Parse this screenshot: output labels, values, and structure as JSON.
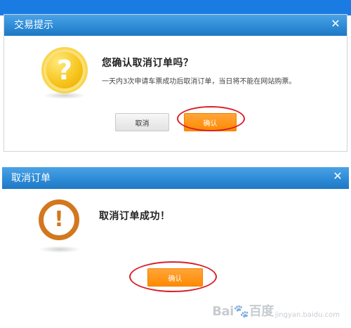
{
  "colors": {
    "top_strip": "#1a7be3",
    "titlebar": "#2e8bd6",
    "confirm_button": "#ff8a00",
    "alert_ring": "#d2781e",
    "question_icon": "#f6c31a",
    "highlight_ellipse": "#d8202a"
  },
  "dialog_trade": {
    "title": "交易提示",
    "close_glyph": "✕",
    "icon": "question-icon",
    "icon_glyph": "?",
    "heading": "您确认取消订单吗？",
    "message": "一天内3次申请车票成功后取消订单，当日将不能在网站购票。",
    "cancel_label": "取消",
    "confirm_label": "确认"
  },
  "dialog_cancel": {
    "title": "取消订单",
    "close_glyph": "✕",
    "icon": "alert-icon",
    "icon_glyph": "!",
    "heading": "取消订单成功！",
    "confirm_label": "确认"
  },
  "watermark": {
    "brand": "Bai🐾百度",
    "caption": "jingyan.baidu.com"
  }
}
